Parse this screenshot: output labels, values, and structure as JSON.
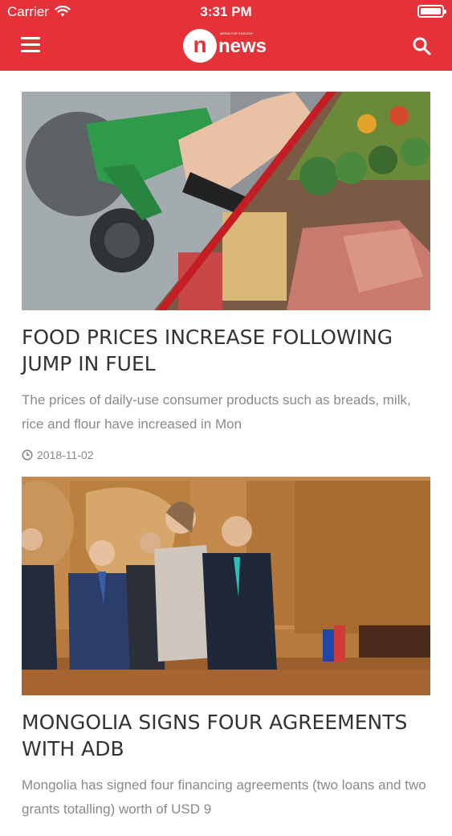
{
  "status_bar": {
    "carrier": "Carrier",
    "time": "3:31 PM"
  },
  "header": {
    "logo_letter": "n",
    "logo_word": "news",
    "logo_tagline": "MEDIA FOR ENGLISH",
    "menu_icon": "hamburger-menu-icon",
    "search_icon": "search-icon",
    "brand_color": "#e53238"
  },
  "articles": [
    {
      "image": "Fuel pump nozzle beside groceries and fresh produce",
      "headline": "FOOD PRICES INCREASE FOLLOWING JUMP IN FUEL",
      "summary": "The prices of daily-use consumer products such as breads, milk, rice and flour have increased in Mon",
      "date": "2018-11-02"
    },
    {
      "image": "Officials signing agreement in a wood-paneled room",
      "headline": "MONGOLIA SIGNS FOUR AGREEMENTS WITH ADB",
      "summary": "Mongolia has signed four financing agreements (two loans and two grants totalling) worth of USD 9",
      "date": ""
    }
  ]
}
